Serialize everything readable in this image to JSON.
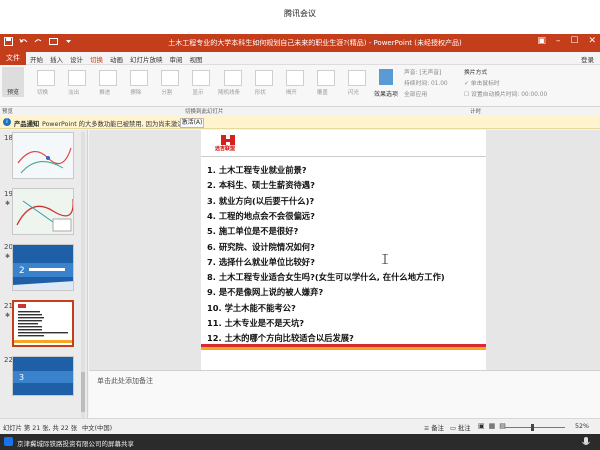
{
  "meeting": {
    "title": "腾讯会议"
  },
  "ppt": {
    "doc_title": "土木工程专业的大学本科生如何规划自己未来的职业生涯?(精品) - PowerPoint (未经授权产品)",
    "menu": {
      "file": "文件",
      "items": [
        "开始",
        "插入",
        "设计",
        "切换",
        "动画",
        "幻灯片放映",
        "审阅",
        "视图"
      ],
      "active_index": 3,
      "login": "登录"
    },
    "ribbon": {
      "preview": "预览",
      "transitions": [
        "切换",
        "淡出",
        "推进",
        "擦除",
        "分割",
        "显示",
        "随机线条",
        "形状",
        "揭开",
        "覆盖",
        "闪光"
      ],
      "effects": "效果选项",
      "sound": "声音: [无声音]",
      "duration": "持续时间: 01.00",
      "apply_all": "全部应用",
      "switch_mode": "换片方式",
      "on_click": "单击鼠标时",
      "after": "设置自动换片时间: 00:00.00",
      "group_preview": "预览",
      "group_trans": "切换到此幻灯片",
      "group_timing": "计时"
    },
    "infobar": {
      "bold": "产品通知",
      "text": "PowerPoint 的大多数功能已被禁用, 因为尚未激活。",
      "button": "激活(A)"
    },
    "thumbnails": [
      {
        "num": "18"
      },
      {
        "num": "19"
      },
      {
        "num": "20"
      },
      {
        "num": "21",
        "selected": true
      },
      {
        "num": "22"
      }
    ],
    "slide": {
      "logo_text": "远吉联盟",
      "questions": [
        "1. 土木工程专业就业前景?",
        "2. 本科生、硕士生薪资待遇?",
        "3. 就业方向(以后要干什么)?",
        "4. 工程的地点会不会很偏远?",
        "5. 施工单位是不是很好?",
        "6. 研究院、设计院情况如何?",
        "7. 选择什么就业单位比较好?",
        "8. 土木工程专业适合女生吗?(女生可以学什么, 在什么地方工作)",
        "9. 是不是像网上说的被人嫌弃?",
        "10. 学土木能不能考公?",
        "11. 土木专业是不是天坑?",
        "12. 土木的哪个方向比较适合以后发展?"
      ]
    },
    "notes_placeholder": "单击此处添加备注",
    "status": {
      "slide_info": "幻灯片 第 21 张, 共 22 张",
      "language": "中文(中国)",
      "notes": "备注",
      "comments": "批注",
      "zoom": "52%"
    }
  },
  "share": {
    "text": "京津冀城际铁路投资有限公司的屏幕共享"
  }
}
